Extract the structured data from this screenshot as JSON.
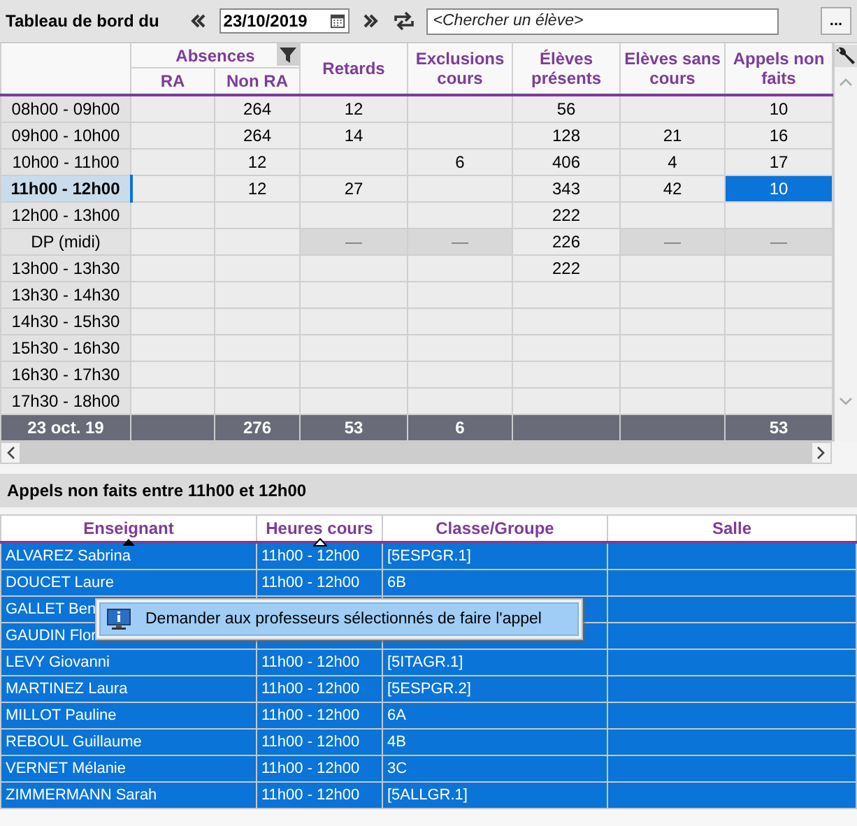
{
  "toolbar": {
    "title": "Tableau de bord du",
    "date": "23/10/2019",
    "search_placeholder": "<Chercher un élève>",
    "more_button": "..."
  },
  "dashboard": {
    "group": {
      "label": "Absences",
      "filtered": true
    },
    "columns": [
      {
        "label": "RA",
        "kind": "sub"
      },
      {
        "label": "Non RA",
        "kind": "sub"
      },
      {
        "label": "Retards",
        "kind": "main"
      },
      {
        "label": "Exclusions cours",
        "kind": "main"
      },
      {
        "label": "Élèves présents",
        "kind": "main"
      },
      {
        "label": "Elèves sans cours",
        "kind": "main"
      },
      {
        "label": "Appels non faits",
        "kind": "main"
      }
    ],
    "rows": [
      {
        "time": "08h00 - 09h00",
        "selected": false,
        "cells": [
          null,
          "264",
          "12",
          null,
          "56",
          null,
          "10"
        ]
      },
      {
        "time": "09h00 - 10h00",
        "selected": false,
        "cells": [
          null,
          "264",
          "14",
          null,
          "128",
          "21",
          "16"
        ]
      },
      {
        "time": "10h00 - 11h00",
        "selected": false,
        "cells": [
          null,
          "12",
          null,
          "6",
          "406",
          "4",
          "17"
        ]
      },
      {
        "time": "11h00 - 12h00",
        "selected": true,
        "cells": [
          null,
          "12",
          "27",
          null,
          "343",
          "42",
          "10"
        ]
      },
      {
        "time": "12h00 - 13h00",
        "selected": false,
        "cells": [
          null,
          null,
          null,
          null,
          "222",
          null,
          null
        ]
      },
      {
        "time": "DP (midi)",
        "selected": false,
        "cells": [
          null,
          null,
          {
            "text": "—",
            "disabled": true
          },
          {
            "text": "—",
            "disabled": true
          },
          "226",
          {
            "text": "—",
            "disabled": true
          },
          {
            "text": "—",
            "disabled": true
          }
        ]
      },
      {
        "time": "13h00 - 13h30",
        "selected": false,
        "cells": [
          null,
          null,
          null,
          null,
          "222",
          null,
          null
        ]
      },
      {
        "time": "13h30 - 14h30",
        "selected": false,
        "cells": [
          null,
          null,
          null,
          null,
          null,
          null,
          null
        ]
      },
      {
        "time": "14h30 - 15h30",
        "selected": false,
        "cells": [
          null,
          null,
          null,
          null,
          null,
          null,
          null
        ]
      },
      {
        "time": "15h30 - 16h30",
        "selected": false,
        "cells": [
          null,
          null,
          null,
          null,
          null,
          null,
          null
        ]
      },
      {
        "time": "16h30 - 17h30",
        "selected": false,
        "cells": [
          null,
          null,
          null,
          null,
          null,
          null,
          null
        ]
      },
      {
        "time": "17h30 - 18h00",
        "selected": false,
        "cells": [
          null,
          null,
          null,
          null,
          null,
          null,
          null
        ]
      }
    ],
    "footer": {
      "label": "23 oct. 19",
      "cells": [
        null,
        "276",
        "53",
        "6",
        null,
        null,
        "53"
      ]
    }
  },
  "section_title": "Appels non faits entre 11h00 et 12h00",
  "calls_table": {
    "columns": [
      {
        "label": "Enseignant",
        "kind": "primary"
      },
      {
        "label": "Heures cours",
        "kind": "secondary"
      },
      {
        "label": "Classe/Groupe",
        "kind": "plain"
      },
      {
        "label": "Salle",
        "kind": "plain"
      }
    ],
    "rows": [
      {
        "selected": true,
        "teacher": "ALVAREZ Sabrina",
        "hours": "11h00 - 12h00",
        "group": "[5ESPGR.1]"
      },
      {
        "selected": true,
        "teacher": "DOUCET Laure",
        "hours": "11h00 - 12h00",
        "group": "6B"
      },
      {
        "selected": true,
        "teacher": "GALLET Ben"
      },
      {
        "selected": true,
        "teacher": "GAUDIN Flor"
      },
      {
        "selected": true,
        "teacher": "LEVY Giovanni",
        "hours": "11h00 - 12h00",
        "group": "[5ITAGR.1]"
      },
      {
        "selected": true,
        "teacher": "MARTINEZ Laura",
        "hours": "11h00 - 12h00",
        "group": "[5ESPGR.2]"
      },
      {
        "selected": true,
        "teacher": "MILLOT Pauline",
        "hours": "11h00 - 12h00",
        "group": "6A"
      },
      {
        "selected": true,
        "teacher": "REBOUL Guillaume",
        "hours": "11h00 - 12h00",
        "group": "4B"
      },
      {
        "selected": true,
        "teacher": "VERNET Mélanie",
        "hours": "11h00 - 12h00",
        "group": "3C"
      },
      {
        "selected": true,
        "teacher": "ZIMMERMANN Sarah",
        "hours": "11h00 - 12h00",
        "group": "[5ALLGR.1]"
      }
    ]
  },
  "context_menu": {
    "items": [
      {
        "label": "Demander aux professeurs sélectionnés de faire l'appel"
      }
    ]
  }
}
